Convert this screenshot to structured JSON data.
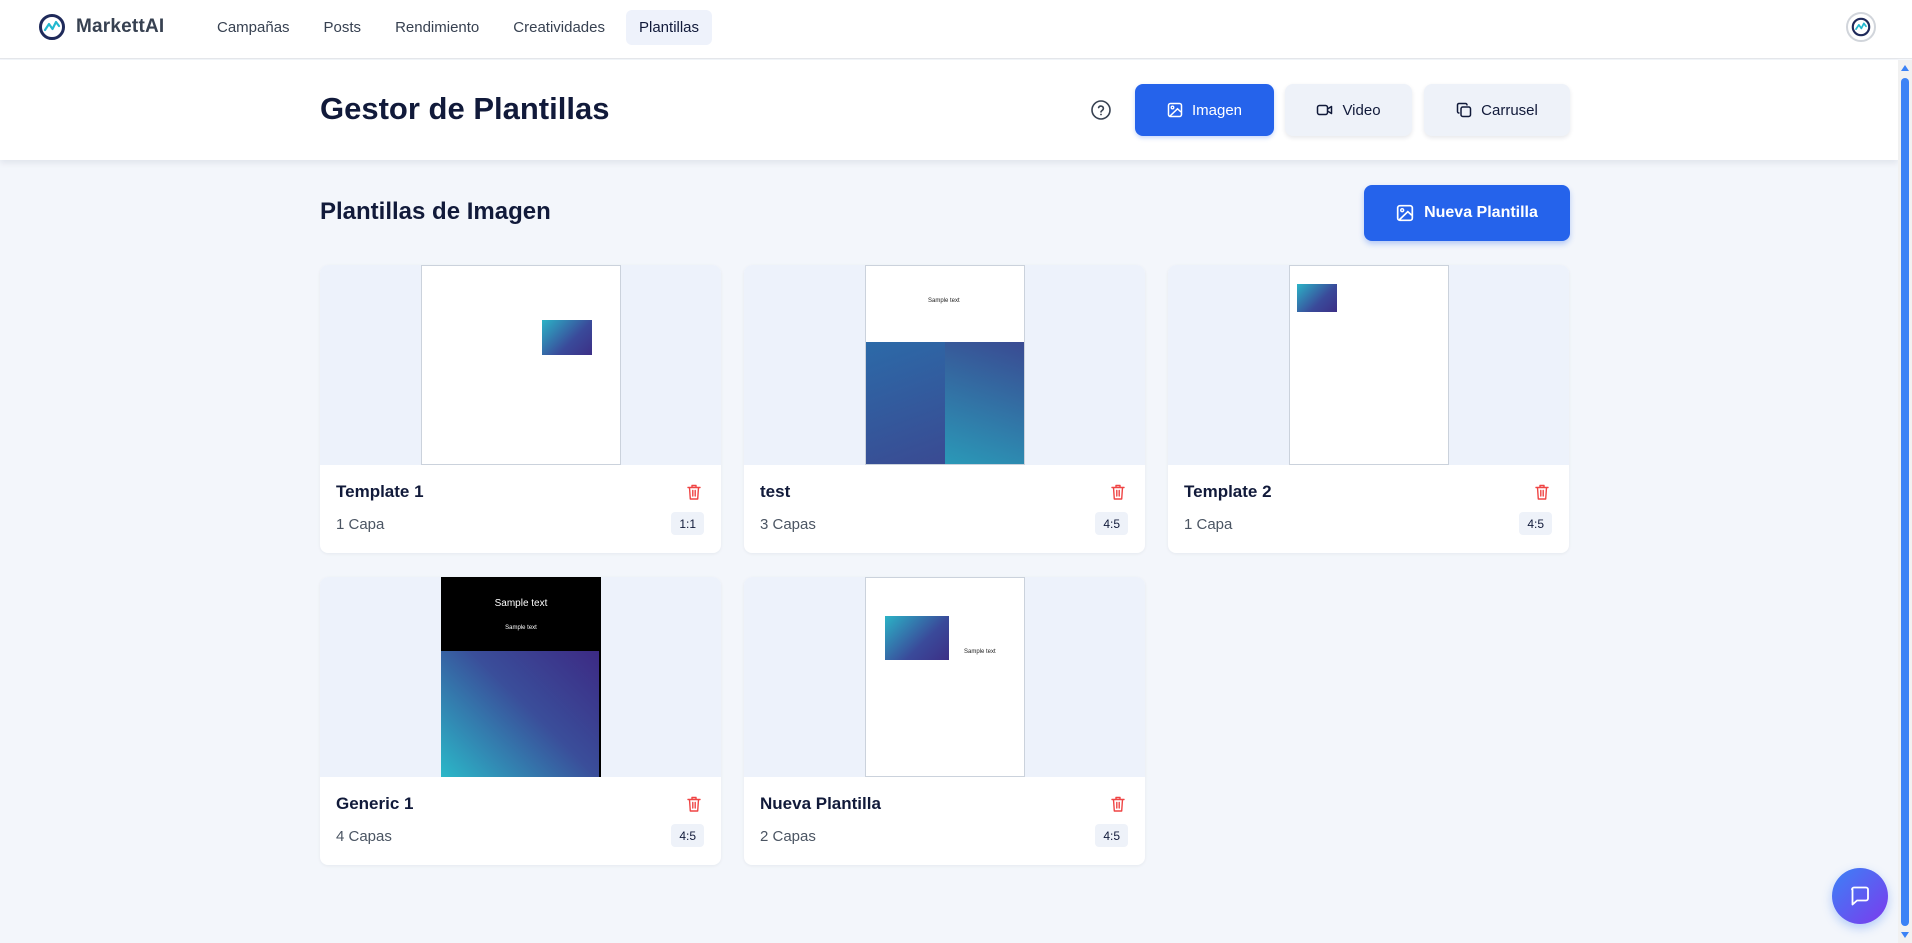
{
  "brand": {
    "name": "MarkettAI"
  },
  "nav": {
    "items": [
      {
        "label": "Campañas",
        "active": false
      },
      {
        "label": "Posts",
        "active": false
      },
      {
        "label": "Rendimiento",
        "active": false
      },
      {
        "label": "Creatividades",
        "active": false
      },
      {
        "label": "Plantillas",
        "active": true
      }
    ]
  },
  "header": {
    "title": "Gestor de Plantillas",
    "help_icon": "question-circle-icon",
    "types": [
      {
        "label": "Imagen",
        "icon": "image-icon",
        "active": true
      },
      {
        "label": "Video",
        "icon": "video-icon",
        "active": false
      },
      {
        "label": "Carrusel",
        "icon": "copy-icon",
        "active": false
      }
    ]
  },
  "section": {
    "title": "Plantillas de Imagen",
    "new_button_label": "Nueva Plantilla"
  },
  "templates": [
    {
      "name": "Template 1",
      "layers": "1 Capa",
      "ratio": "1:1"
    },
    {
      "name": "test",
      "layers": "3 Capas",
      "ratio": "4:5",
      "sample_text": "Sample text"
    },
    {
      "name": "Template 2",
      "layers": "1 Capa",
      "ratio": "4:5"
    },
    {
      "name": "Generic 1",
      "layers": "4 Capas",
      "ratio": "4:5",
      "sample_text_large": "Sample text",
      "sample_text_small": "Sample text"
    },
    {
      "name": "Nueva Plantilla",
      "layers": "2 Capas",
      "ratio": "4:5",
      "sample_text": "Sample text"
    }
  ],
  "colors": {
    "accent": "#2563eb",
    "delete": "#ef4444",
    "title": "#111a3a"
  }
}
